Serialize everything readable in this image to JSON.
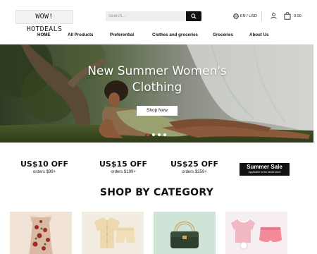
{
  "header": {
    "logo_text": "WOW! HOTDEALS",
    "search": {
      "placeholder": "Search...",
      "button_icon": "search-icon"
    },
    "language_currency": "EN / USD",
    "cart_total": "0.00",
    "icons": [
      "globe-icon",
      "user-icon",
      "shopping-bag-icon"
    ]
  },
  "nav": {
    "items": [
      "HOME",
      "All Products",
      "Preferential",
      "Clothes and groceries",
      "Groceries",
      "About Us"
    ]
  },
  "hero": {
    "title_line1": "New Summer Women's",
    "title_line2": "Clothing",
    "button_label": "Shop Now",
    "slide_count": 4,
    "active_slide": 1
  },
  "promos": [
    {
      "amount": "US$10 OFF",
      "condition": "orders $99+"
    },
    {
      "amount": "US$15 OFF",
      "condition": "orders $199+"
    },
    {
      "amount": "US$25 OFF",
      "condition": "orders $259+"
    }
  ],
  "summer_sale": {
    "title": "Summer Sale",
    "subtitle": "Applicable to the whole store"
  },
  "category_section": {
    "title": "SHOP BY CATEGORY"
  },
  "categories": [
    {
      "image": "floral-dress"
    },
    {
      "image": "satin-pajama-set"
    },
    {
      "image": "green-handbag"
    },
    {
      "image": "kids-pink-outfit"
    }
  ],
  "colors": {
    "accent": "#111111",
    "active_dot": "#c24a3a",
    "page_bg": "#ffffff"
  }
}
